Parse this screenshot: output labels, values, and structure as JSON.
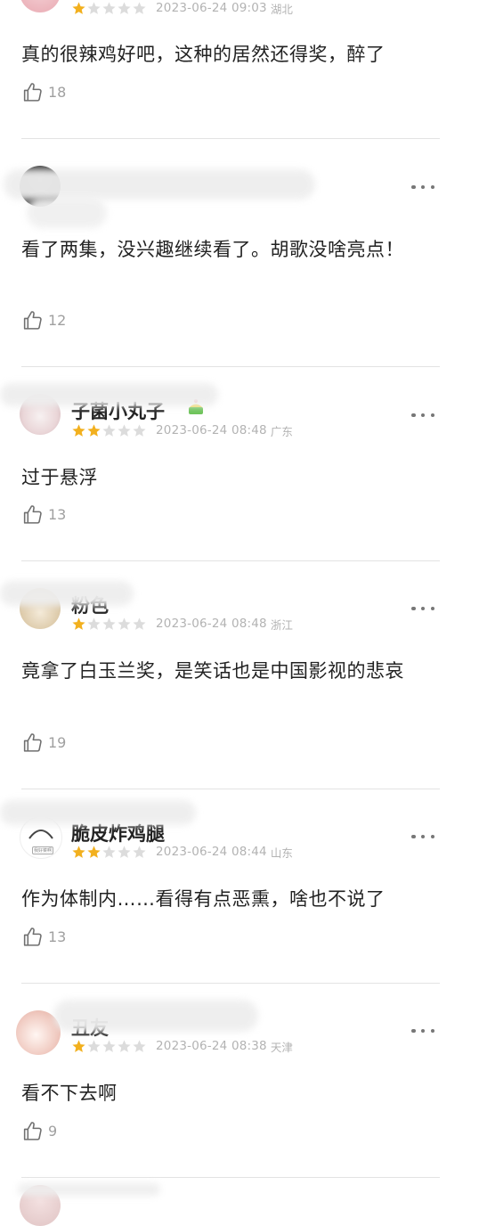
{
  "comments": [
    {
      "username": "",
      "rating": 1,
      "time": "2023-06-24 09:03",
      "region": "湖北",
      "text": "真的很辣鸡好吧，这种的居然还得奖，醉了",
      "likes": "18"
    },
    {
      "username": "",
      "rating": 0,
      "time": "",
      "region": "",
      "text": "看了两集，没兴趣继续看了。胡歌没啥亮点！",
      "likes": "12"
    },
    {
      "username": "子菌小丸子",
      "rating": 2,
      "time": "2023-06-24 08:48",
      "region": "广东",
      "text": "过于悬浮",
      "likes": "13"
    },
    {
      "username": "粉色",
      "rating": 1,
      "time": "2023-06-24 08:48",
      "region": "浙江",
      "text": "竟拿了白玉兰奖，是笑话也是中国影视的悲哀",
      "likes": "19"
    },
    {
      "username": "脆皮炸鸡腿",
      "rating": 2,
      "time": "2023-06-24 08:44",
      "region": "山东",
      "text": "作为体制内……看得有点恶熏，啥也不说了",
      "likes": "13"
    },
    {
      "username": "丑友",
      "rating": 1,
      "time": "2023-06-24 08:38",
      "region": "天津",
      "text": "看不下去啊",
      "likes": "9"
    }
  ],
  "icons": {
    "star_filled_color": "#f2b01e",
    "star_empty_color": "#dcdcdc",
    "like_icon": "thumbs-up-outline",
    "more_icon": "ellipsis-horizontal"
  },
  "avatar_badge_text": "我好菜啊"
}
